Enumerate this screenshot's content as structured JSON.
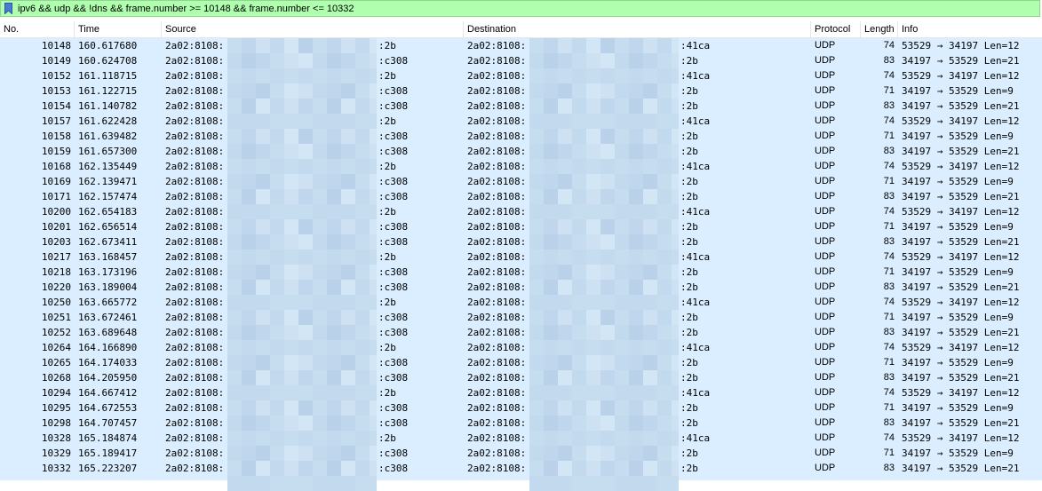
{
  "filter": {
    "expression": "ipv6 && udp && !dns && frame.number >= 10148 && frame.number <= 10332",
    "colors": {
      "valid_bg": "#afffaf"
    }
  },
  "columns": {
    "no": "No.",
    "time": "Time",
    "source": "Source",
    "destination": "Destination",
    "protocol": "Protocol",
    "length": "Length",
    "info": "Info"
  },
  "row_color": "#daeeff",
  "packets": [
    {
      "no": "10148",
      "time": "160.617680",
      "src_prefix": "2a02:8108:",
      "src_suffix": ":2b",
      "dst_prefix": "2a02:8108:",
      "dst_suffix": ":41ca",
      "protocol": "UDP",
      "length": "74",
      "info": "53529 → 34197 Len=12"
    },
    {
      "no": "10149",
      "time": "160.624708",
      "src_prefix": "2a02:8108:",
      "src_suffix": ":c308",
      "dst_prefix": "2a02:8108:",
      "dst_suffix": ":2b",
      "protocol": "UDP",
      "length": "83",
      "info": "34197 → 53529 Len=21"
    },
    {
      "no": "10152",
      "time": "161.118715",
      "src_prefix": "2a02:8108:",
      "src_suffix": ":2b",
      "dst_prefix": "2a02:8108:",
      "dst_suffix": ":41ca",
      "protocol": "UDP",
      "length": "74",
      "info": "53529 → 34197 Len=12"
    },
    {
      "no": "10153",
      "time": "161.122715",
      "src_prefix": "2a02:8108:",
      "src_suffix": ":c308",
      "dst_prefix": "2a02:8108:",
      "dst_suffix": ":2b",
      "protocol": "UDP",
      "length": "71",
      "info": "34197 → 53529 Len=9"
    },
    {
      "no": "10154",
      "time": "161.140782",
      "src_prefix": "2a02:8108:",
      "src_suffix": ":c308",
      "dst_prefix": "2a02:8108:",
      "dst_suffix": ":2b",
      "protocol": "UDP",
      "length": "83",
      "info": "34197 → 53529 Len=21"
    },
    {
      "no": "10157",
      "time": "161.622428",
      "src_prefix": "2a02:8108:",
      "src_suffix": ":2b",
      "dst_prefix": "2a02:8108:",
      "dst_suffix": ":41ca",
      "protocol": "UDP",
      "length": "74",
      "info": "53529 → 34197 Len=12"
    },
    {
      "no": "10158",
      "time": "161.639482",
      "src_prefix": "2a02:8108:",
      "src_suffix": ":c308",
      "dst_prefix": "2a02:8108:",
      "dst_suffix": ":2b",
      "protocol": "UDP",
      "length": "71",
      "info": "34197 → 53529 Len=9"
    },
    {
      "no": "10159",
      "time": "161.657300",
      "src_prefix": "2a02:8108:",
      "src_suffix": ":c308",
      "dst_prefix": "2a02:8108:",
      "dst_suffix": ":2b",
      "protocol": "UDP",
      "length": "83",
      "info": "34197 → 53529 Len=21"
    },
    {
      "no": "10168",
      "time": "162.135449",
      "src_prefix": "2a02:8108:",
      "src_suffix": ":2b",
      "dst_prefix": "2a02:8108:",
      "dst_suffix": ":41ca",
      "protocol": "UDP",
      "length": "74",
      "info": "53529 → 34197 Len=12"
    },
    {
      "no": "10169",
      "time": "162.139471",
      "src_prefix": "2a02:8108:",
      "src_suffix": ":c308",
      "dst_prefix": "2a02:8108:",
      "dst_suffix": ":2b",
      "protocol": "UDP",
      "length": "71",
      "info": "34197 → 53529 Len=9"
    },
    {
      "no": "10171",
      "time": "162.157474",
      "src_prefix": "2a02:8108:",
      "src_suffix": ":c308",
      "dst_prefix": "2a02:8108:",
      "dst_suffix": ":2b",
      "protocol": "UDP",
      "length": "83",
      "info": "34197 → 53529 Len=21"
    },
    {
      "no": "10200",
      "time": "162.654183",
      "src_prefix": "2a02:8108:",
      "src_suffix": ":2b",
      "dst_prefix": "2a02:8108:",
      "dst_suffix": ":41ca",
      "protocol": "UDP",
      "length": "74",
      "info": "53529 → 34197 Len=12"
    },
    {
      "no": "10201",
      "time": "162.656514",
      "src_prefix": "2a02:8108:",
      "src_suffix": ":c308",
      "dst_prefix": "2a02:8108:",
      "dst_suffix": ":2b",
      "protocol": "UDP",
      "length": "71",
      "info": "34197 → 53529 Len=9"
    },
    {
      "no": "10203",
      "time": "162.673411",
      "src_prefix": "2a02:8108:",
      "src_suffix": ":c308",
      "dst_prefix": "2a02:8108:",
      "dst_suffix": ":2b",
      "protocol": "UDP",
      "length": "83",
      "info": "34197 → 53529 Len=21"
    },
    {
      "no": "10217",
      "time": "163.168457",
      "src_prefix": "2a02:8108:",
      "src_suffix": ":2b",
      "dst_prefix": "2a02:8108:",
      "dst_suffix": ":41ca",
      "protocol": "UDP",
      "length": "74",
      "info": "53529 → 34197 Len=12"
    },
    {
      "no": "10218",
      "time": "163.173196",
      "src_prefix": "2a02:8108:",
      "src_suffix": ":c308",
      "dst_prefix": "2a02:8108:",
      "dst_suffix": ":2b",
      "protocol": "UDP",
      "length": "71",
      "info": "34197 → 53529 Len=9"
    },
    {
      "no": "10220",
      "time": "163.189004",
      "src_prefix": "2a02:8108:",
      "src_suffix": ":c308",
      "dst_prefix": "2a02:8108:",
      "dst_suffix": ":2b",
      "protocol": "UDP",
      "length": "83",
      "info": "34197 → 53529 Len=21"
    },
    {
      "no": "10250",
      "time": "163.665772",
      "src_prefix": "2a02:8108:",
      "src_suffix": ":2b",
      "dst_prefix": "2a02:8108:",
      "dst_suffix": ":41ca",
      "protocol": "UDP",
      "length": "74",
      "info": "53529 → 34197 Len=12"
    },
    {
      "no": "10251",
      "time": "163.672461",
      "src_prefix": "2a02:8108:",
      "src_suffix": ":c308",
      "dst_prefix": "2a02:8108:",
      "dst_suffix": ":2b",
      "protocol": "UDP",
      "length": "71",
      "info": "34197 → 53529 Len=9"
    },
    {
      "no": "10252",
      "time": "163.689648",
      "src_prefix": "2a02:8108:",
      "src_suffix": ":c308",
      "dst_prefix": "2a02:8108:",
      "dst_suffix": ":2b",
      "protocol": "UDP",
      "length": "83",
      "info": "34197 → 53529 Len=21"
    },
    {
      "no": "10264",
      "time": "164.166890",
      "src_prefix": "2a02:8108:",
      "src_suffix": ":2b",
      "dst_prefix": "2a02:8108:",
      "dst_suffix": ":41ca",
      "protocol": "UDP",
      "length": "74",
      "info": "53529 → 34197 Len=12"
    },
    {
      "no": "10265",
      "time": "164.174033",
      "src_prefix": "2a02:8108:",
      "src_suffix": ":c308",
      "dst_prefix": "2a02:8108:",
      "dst_suffix": ":2b",
      "protocol": "UDP",
      "length": "71",
      "info": "34197 → 53529 Len=9"
    },
    {
      "no": "10268",
      "time": "164.205950",
      "src_prefix": "2a02:8108:",
      "src_suffix": ":c308",
      "dst_prefix": "2a02:8108:",
      "dst_suffix": ":2b",
      "protocol": "UDP",
      "length": "83",
      "info": "34197 → 53529 Len=21"
    },
    {
      "no": "10294",
      "time": "164.667412",
      "src_prefix": "2a02:8108:",
      "src_suffix": ":2b",
      "dst_prefix": "2a02:8108:",
      "dst_suffix": ":41ca",
      "protocol": "UDP",
      "length": "74",
      "info": "53529 → 34197 Len=12"
    },
    {
      "no": "10295",
      "time": "164.672553",
      "src_prefix": "2a02:8108:",
      "src_suffix": ":c308",
      "dst_prefix": "2a02:8108:",
      "dst_suffix": ":2b",
      "protocol": "UDP",
      "length": "71",
      "info": "34197 → 53529 Len=9"
    },
    {
      "no": "10298",
      "time": "164.707457",
      "src_prefix": "2a02:8108:",
      "src_suffix": ":c308",
      "dst_prefix": "2a02:8108:",
      "dst_suffix": ":2b",
      "protocol": "UDP",
      "length": "83",
      "info": "34197 → 53529 Len=21"
    },
    {
      "no": "10328",
      "time": "165.184874",
      "src_prefix": "2a02:8108:",
      "src_suffix": ":2b",
      "dst_prefix": "2a02:8108:",
      "dst_suffix": ":41ca",
      "protocol": "UDP",
      "length": "74",
      "info": "53529 → 34197 Len=12"
    },
    {
      "no": "10329",
      "time": "165.189417",
      "src_prefix": "2a02:8108:",
      "src_suffix": ":c308",
      "dst_prefix": "2a02:8108:",
      "dst_suffix": ":2b",
      "protocol": "UDP",
      "length": "71",
      "info": "34197 → 53529 Len=9"
    },
    {
      "no": "10332",
      "time": "165.223207",
      "src_prefix": "2a02:8108:",
      "src_suffix": ":c308",
      "dst_prefix": "2a02:8108:",
      "dst_suffix": ":2b",
      "protocol": "UDP",
      "length": "83",
      "info": "34197 → 53529 Len=21"
    }
  ]
}
